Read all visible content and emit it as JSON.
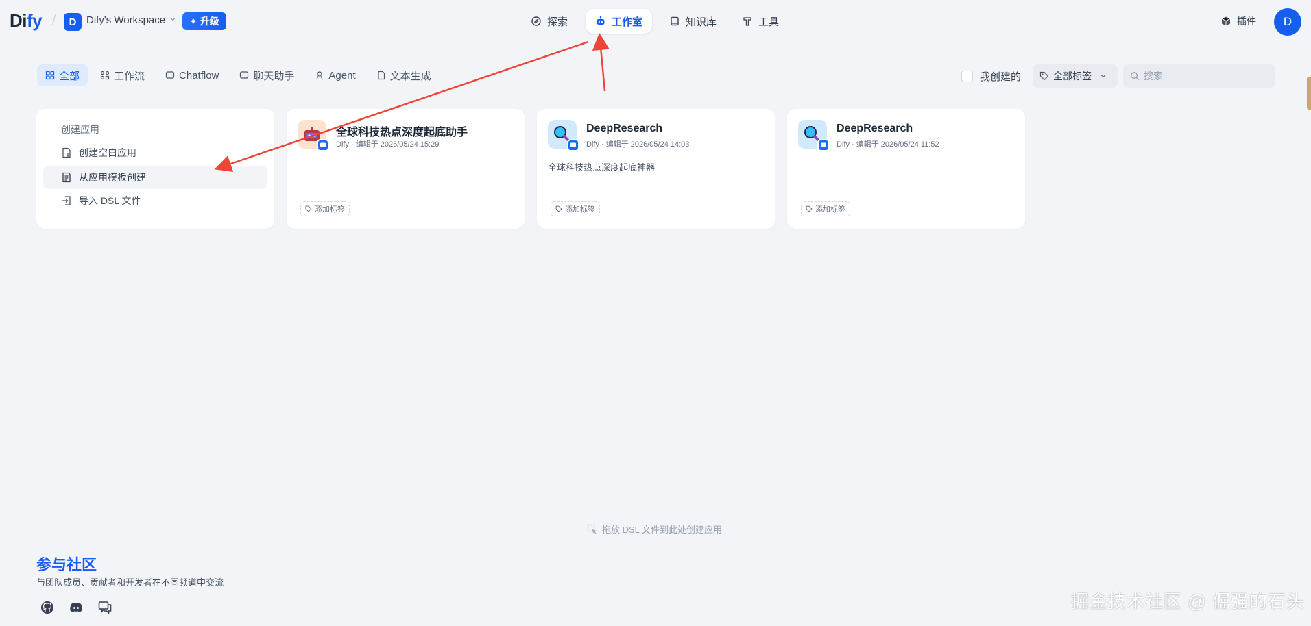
{
  "header": {
    "logo_main": "Di",
    "logo_accent": "fy",
    "workspace_initial": "D",
    "workspace_name": "Dify's Workspace",
    "upgrade_label": "升级",
    "nav": [
      {
        "label": "探索"
      },
      {
        "label": "工作室"
      },
      {
        "label": "知识库"
      },
      {
        "label": "工具"
      }
    ],
    "plugin_label": "插件",
    "user_initial": "D"
  },
  "filters": {
    "tabs": [
      {
        "label": "全部"
      },
      {
        "label": "工作流"
      },
      {
        "label": "Chatflow"
      },
      {
        "label": "聊天助手"
      },
      {
        "label": "Agent"
      },
      {
        "label": "文本生成"
      }
    ],
    "mine_label": "我创建的",
    "tag_select": "全部标签",
    "search_placeholder": "搜索"
  },
  "create_card": {
    "title": "创建应用",
    "items": [
      {
        "label": "创建空白应用"
      },
      {
        "label": "从应用模板创建"
      },
      {
        "label": "导入 DSL 文件"
      }
    ]
  },
  "apps": [
    {
      "name": "全球科技热点深度起底助手",
      "meta": "Dify · 编辑于 2026/05/24 15:29",
      "description": "",
      "add_tag": "添加标签"
    },
    {
      "name": "DeepResearch",
      "meta": "Dify · 编辑于 2026/05/24 14:03",
      "description": "全球科技热点深度起底神器",
      "add_tag": "添加标签"
    },
    {
      "name": "DeepResearch",
      "meta": "Dify · 编辑于 2026/05/24 11:52",
      "description": "",
      "add_tag": "添加标签"
    }
  ],
  "footer": {
    "dsl_hint": "拖放 DSL 文件到此处创建应用",
    "community_title": "参与社区",
    "community_desc": "与团队成员、贡献者和开发者在不同频道中交流",
    "watermark": "掘金技术社区 @ 倔强的石头_"
  },
  "colors": {
    "accent": "#155eef",
    "annotation_arrow": "#f04438",
    "background": "#f2f4f7"
  }
}
